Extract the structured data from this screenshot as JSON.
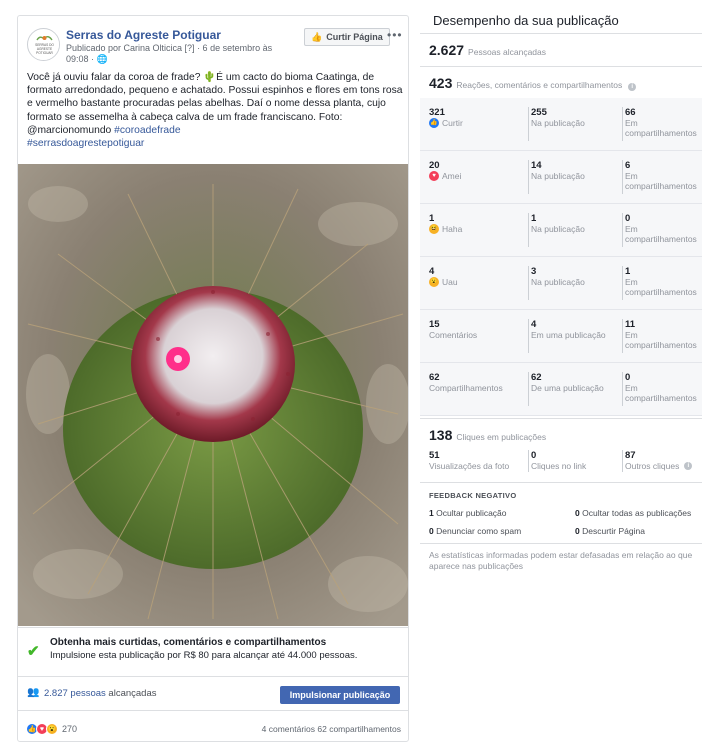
{
  "post": {
    "page_name": "Serras do Agreste Potiguar",
    "logo_text": [
      "SERRAS DO",
      "AGRESTE",
      "POTIGUAR"
    ],
    "publisher": "Publicado por Carina Olticica [?] · 6 de setembro às 09:08 · 🌐",
    "like_page_label": "Curtir Página",
    "more_label": "•••",
    "text_main": "Você já ouviu falar da coroa de frade? 🌵É um cacto do bioma Caatinga, de formato arredondado, pequeno e achatado. Possui espinhos e flores em tons rosa e vermelho bastante procuradas pelas abelhas. Daí o nome dessa planta, cujo formato se assemelha à cabeça calva de um frade franciscano. Foto: @marcionomundo ",
    "hashtag_1": "#coroadefrade",
    "hashtag_2": "#serrasdoagrestepotiguar",
    "boost_title": "Obtenha mais curtidas, comentários e compartilhamentos",
    "boost_sub": "Impulsione esta publicação por R$ 80 para alcançar até 44.000 pessoas.",
    "reach_link": "2.827 pessoas",
    "reach_suffix": " alcançadas",
    "boost_button": "Impulsionar publicação",
    "reaction_count": "270",
    "comments_shares": "4 comentários  62 compartilhamentos"
  },
  "panel": {
    "title": "Desempenho da sua publicação",
    "people_reached_num": "2.627",
    "people_reached_label": "Pessoas alcançadas",
    "engagement_num": "423",
    "engagement_label": "Reações, comentários e compartilhamentos",
    "rows": [
      {
        "n1": "321",
        "l1": "Curtir",
        "n2": "255",
        "l2": "Na publicação",
        "n3": "66",
        "l3": "Em compartilhamentos",
        "icon": "like-icon",
        "color": "#2078f4",
        "glyph": "👍"
      },
      {
        "n1": "20",
        "l1": "Amei",
        "n2": "14",
        "l2": "Na publicação",
        "n3": "6",
        "l3": "Em compartilhamentos",
        "icon": "love-icon",
        "color": "#f33e58",
        "glyph": "♥"
      },
      {
        "n1": "1",
        "l1": "Haha",
        "n2": "1",
        "l2": "Na publicação",
        "n3": "0",
        "l3": "Em compartilhamentos",
        "icon": "haha-icon",
        "color": "#f7b125",
        "glyph": "😆"
      },
      {
        "n1": "4",
        "l1": "Uau",
        "n2": "3",
        "l2": "Na publicação",
        "n3": "1",
        "l3": "Em compartilhamentos",
        "icon": "wow-icon",
        "color": "#f7b125",
        "glyph": "😮"
      },
      {
        "n1": "15",
        "l1": "Comentários",
        "n2": "4",
        "l2": "Em uma publicação",
        "n3": "11",
        "l3": "Em compartilhamentos",
        "icon": "",
        "color": "",
        "glyph": ""
      },
      {
        "n1": "62",
        "l1": "Compartilhamentos",
        "n2": "62",
        "l2": "De uma publicação",
        "n3": "0",
        "l3": "Em compartilhamentos",
        "icon": "",
        "color": "",
        "glyph": ""
      }
    ],
    "clicks_num": "138",
    "clicks_label": "Cliques em publicações",
    "clicks": [
      {
        "n": "51",
        "l": "Visualizações da foto"
      },
      {
        "n": "0",
        "l": "Cliques no link"
      },
      {
        "n": "87",
        "l": "Outros cliques"
      }
    ],
    "negative_title": "FEEDBACK NEGATIVO",
    "negative": [
      {
        "n": "1",
        "l": "Ocultar publicação"
      },
      {
        "n": "0",
        "l": "Ocultar todas as publicações"
      },
      {
        "n": "0",
        "l": "Denunciar como spam"
      },
      {
        "n": "0",
        "l": "Descurtir Página"
      }
    ],
    "disclaimer": "As estatísticas informadas podem estar defasadas em relação ao que aparece nas publicações"
  },
  "colors": {
    "link": "#365899",
    "boost_button": "#4267b2",
    "check": "#42b72a"
  }
}
